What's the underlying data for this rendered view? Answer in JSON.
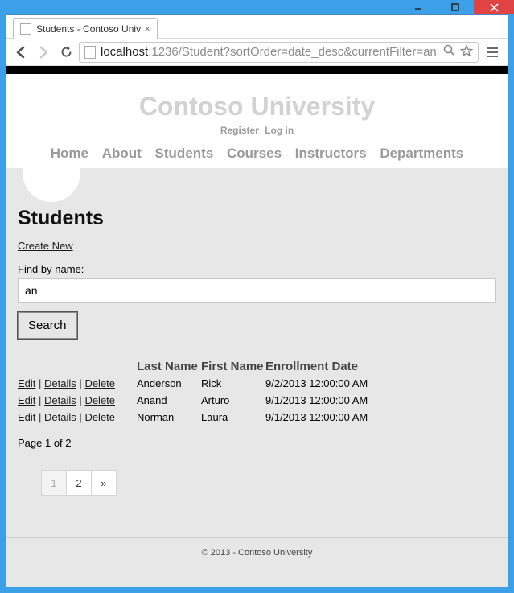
{
  "window": {
    "tab_title": "Students - Contoso Univer",
    "url_host": "localhost",
    "url_rest": ":1236/Student?sortOrder=date_desc&currentFilter=an"
  },
  "site": {
    "title": "Contoso University",
    "auth": {
      "register": "Register",
      "login": "Log in"
    },
    "nav": {
      "home": "Home",
      "about": "About",
      "students": "Students",
      "courses": "Courses",
      "instructors": "Instructors",
      "departments": "Departments"
    }
  },
  "page": {
    "heading": "Students",
    "create_new": "Create New",
    "find_label": "Find by name:",
    "search_value": "an",
    "search_button": "Search",
    "columns": {
      "last_name": "Last Name",
      "first_name": "First Name",
      "enrollment_date": "Enrollment Date"
    },
    "actions": {
      "edit": "Edit",
      "details": "Details",
      "delete": "Delete"
    },
    "rows": [
      {
        "last": "Anderson",
        "first": "Rick",
        "date": "9/2/2013 12:00:00 AM"
      },
      {
        "last": "Anand",
        "first": "Arturo",
        "date": "9/1/2013 12:00:00 AM"
      },
      {
        "last": "Norman",
        "first": "Laura",
        "date": "9/1/2013 12:00:00 AM"
      }
    ],
    "page_info": "Page 1 of 2",
    "pager": {
      "p1": "1",
      "p2": "2",
      "next": "»"
    }
  },
  "footer": {
    "text": "© 2013 - Contoso University"
  }
}
